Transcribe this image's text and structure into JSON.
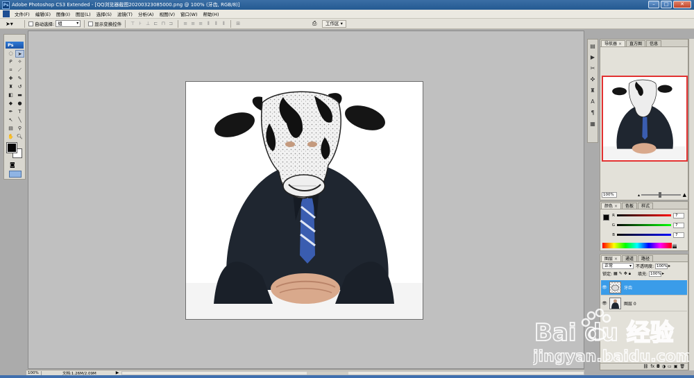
{
  "window": {
    "title": "Adobe Photoshop CS3 Extended - [QQ浏览器截图20200323085000.png @ 100% (牙齿, RGB/8)]",
    "minimize": "–",
    "maximize": "□",
    "close": "✕"
  },
  "menu": [
    "文件(F)",
    "编辑(E)",
    "图像(I)",
    "图层(L)",
    "选择(S)",
    "滤镜(T)",
    "分析(A)",
    "视图(V)",
    "窗口(W)",
    "帮助(H)"
  ],
  "options": {
    "auto_select_label": "自动选择:",
    "auto_select_value": "组",
    "show_transform_label": "显示变换控件",
    "workspace_label": "工作区 ▾"
  },
  "toolbox": {
    "logo": "Ps",
    "fg_color": "#070707",
    "bg_color": "#ffffff"
  },
  "statusbar": {
    "zoom": "100%",
    "doc_info": "文档:1.26M/2.09M",
    "arrow": "▶"
  },
  "navigator": {
    "tabs": [
      "导航器",
      "直方图",
      "信息"
    ],
    "zoom": "100%",
    "proxy_color": "#e23030"
  },
  "color_panel": {
    "tabs": [
      "颜色",
      "色板",
      "样式"
    ],
    "channels": [
      {
        "label": "R",
        "value": "7"
      },
      {
        "label": "G",
        "value": "7"
      },
      {
        "label": "B",
        "value": "7"
      }
    ]
  },
  "layers_panel": {
    "tabs": [
      "图层",
      "通道",
      "路径"
    ],
    "blend_mode": "正常",
    "opacity_label": "不透明度:",
    "opacity_value": "100%",
    "lock_label": "锁定:",
    "fill_label": "填充:",
    "fill_value": "100%",
    "layers": [
      {
        "name": "牙齿",
        "selected": true
      },
      {
        "name": "图层 0",
        "selected": false
      }
    ],
    "selected_color": "#3a9ce9"
  },
  "watermark": {
    "brand": "Bai du 经验",
    "url": "jingyan.baidu.com"
  }
}
